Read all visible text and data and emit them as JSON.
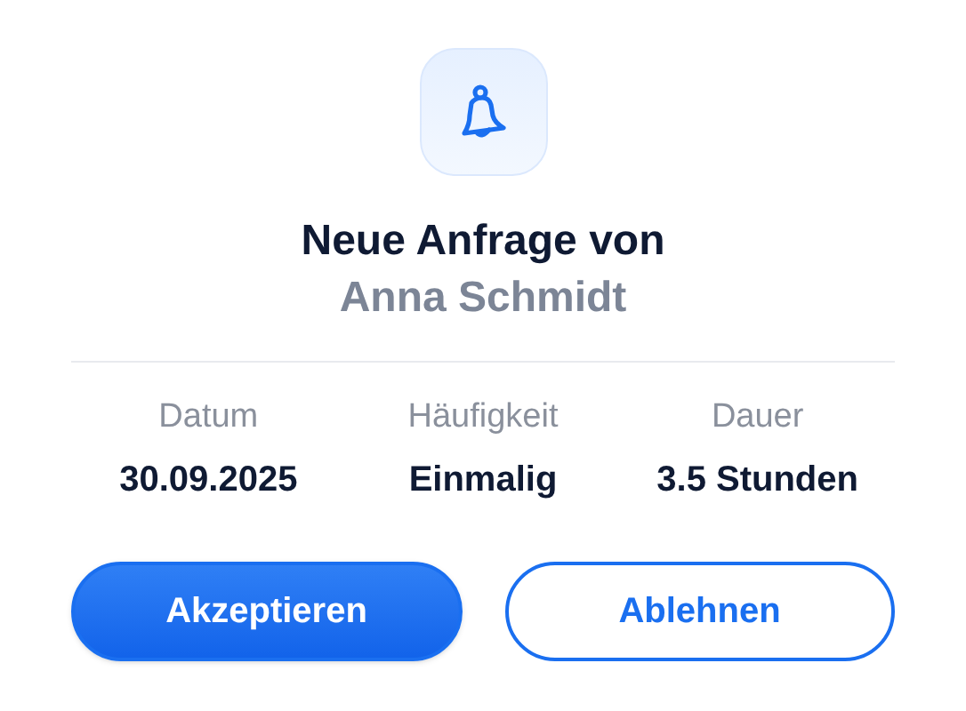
{
  "title": "Neue Anfrage von",
  "requester": "Anna Schmidt",
  "details": [
    {
      "label": "Datum",
      "value": "30.09.2025"
    },
    {
      "label": "Häufigkeit",
      "value": "Einmalig"
    },
    {
      "label": "Dauer",
      "value": "3.5 Stunden"
    }
  ],
  "buttons": [
    {
      "label": "Akzeptieren",
      "kind": "primary"
    },
    {
      "label": "Ablehnen",
      "kind": "secondary"
    }
  ]
}
